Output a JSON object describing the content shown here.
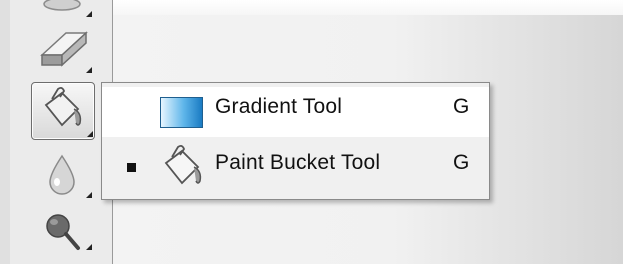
{
  "toolbar": {
    "tools": [
      {
        "name": "blur-tool",
        "icon": "stamp-icon"
      },
      {
        "name": "eraser-tool",
        "icon": "eraser-icon"
      },
      {
        "name": "paint-bucket-tool",
        "icon": "paint-bucket-icon",
        "active": true
      },
      {
        "name": "blur-tool",
        "icon": "water-drop-icon"
      },
      {
        "name": "dodge-tool",
        "icon": "dodge-icon"
      }
    ]
  },
  "flyout": {
    "items": [
      {
        "label": "Gradient Tool",
        "shortcut": "G",
        "icon": "gradient-icon",
        "selected": false
      },
      {
        "label": "Paint Bucket Tool",
        "shortcut": "G",
        "icon": "paint-bucket-icon",
        "selected": true
      }
    ]
  },
  "colors": {
    "toolbar_bg": "#ebebeb",
    "menu_bg": "#f0f0f0",
    "gradient_start": "#e8f6ff",
    "gradient_end": "#1a7bc3"
  }
}
